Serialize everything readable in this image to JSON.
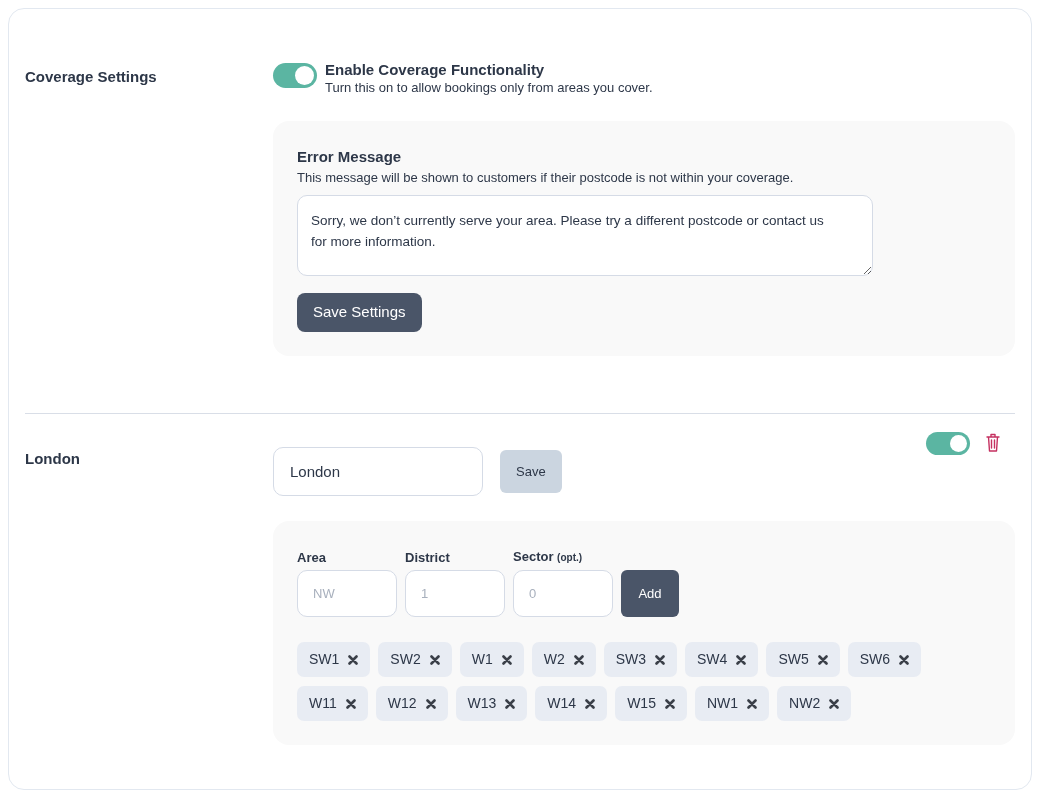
{
  "coverage_settings": {
    "label": "Coverage Settings",
    "toggle": {
      "on": true,
      "title": "Enable Coverage Functionality",
      "description": "Turn this on to allow bookings only from areas you cover."
    },
    "error_message": {
      "label": "Error Message",
      "hint": "This message will be shown to customers if their postcode is not within your coverage.",
      "value": "Sorry, we don’t currently serve your area. Please try a different postcode or contact us for more information.",
      "button": "Save Settings"
    }
  },
  "regions": [
    {
      "label": "London",
      "name_field": {
        "value": "London"
      },
      "save_button": "Save",
      "on": true,
      "postcode_form": {
        "fields": [
          {
            "label": "Area",
            "placeholder": "NW"
          },
          {
            "label": "District",
            "placeholder": "1"
          },
          {
            "label": "Sector",
            "note": "(opt.)",
            "placeholder": "0"
          }
        ],
        "add_button": "Add"
      },
      "postcodes": [
        "SW1",
        "SW2",
        "W1",
        "W2",
        "SW3",
        "SW4",
        "SW5",
        "SW6",
        "W11",
        "W12",
        "W13",
        "W14",
        "W15",
        "NW1",
        "NW2"
      ]
    }
  ]
}
